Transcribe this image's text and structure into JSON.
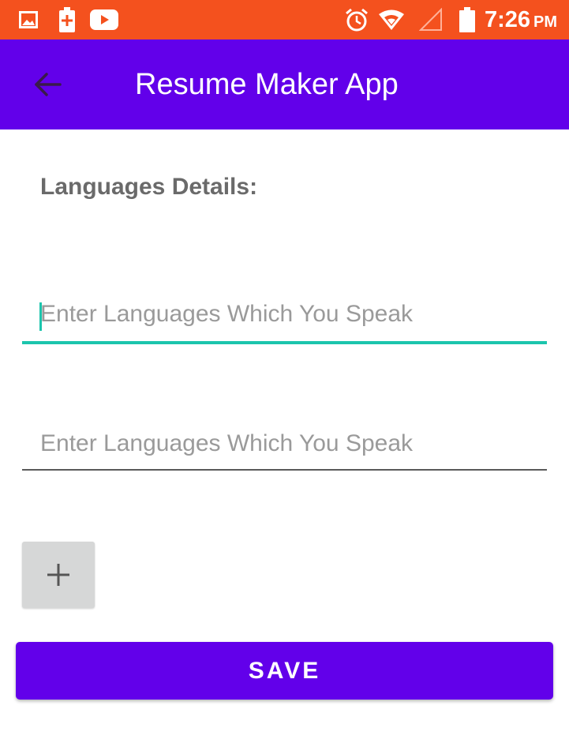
{
  "status_bar": {
    "time": "7:26",
    "ampm": "PM",
    "color": "#f4511e",
    "icons": [
      "gallery-icon",
      "battery-saver-icon",
      "youtube-icon",
      "alarm-icon",
      "wifi-icon",
      "signal-icon",
      "battery-icon"
    ]
  },
  "app_bar": {
    "title": "Resume Maker App",
    "color": "#6200ea",
    "back_icon": "arrow-back-icon"
  },
  "form": {
    "heading": "Languages Details:",
    "fields": [
      {
        "placeholder": "Enter Languages Which You Speak",
        "value": "",
        "focused": true
      },
      {
        "placeholder": "Enter Languages Which You Speak",
        "value": "",
        "focused": false
      }
    ],
    "accent_color": "#1cc5ad",
    "add_icon": "plus-icon",
    "save_label": "SAVE"
  }
}
